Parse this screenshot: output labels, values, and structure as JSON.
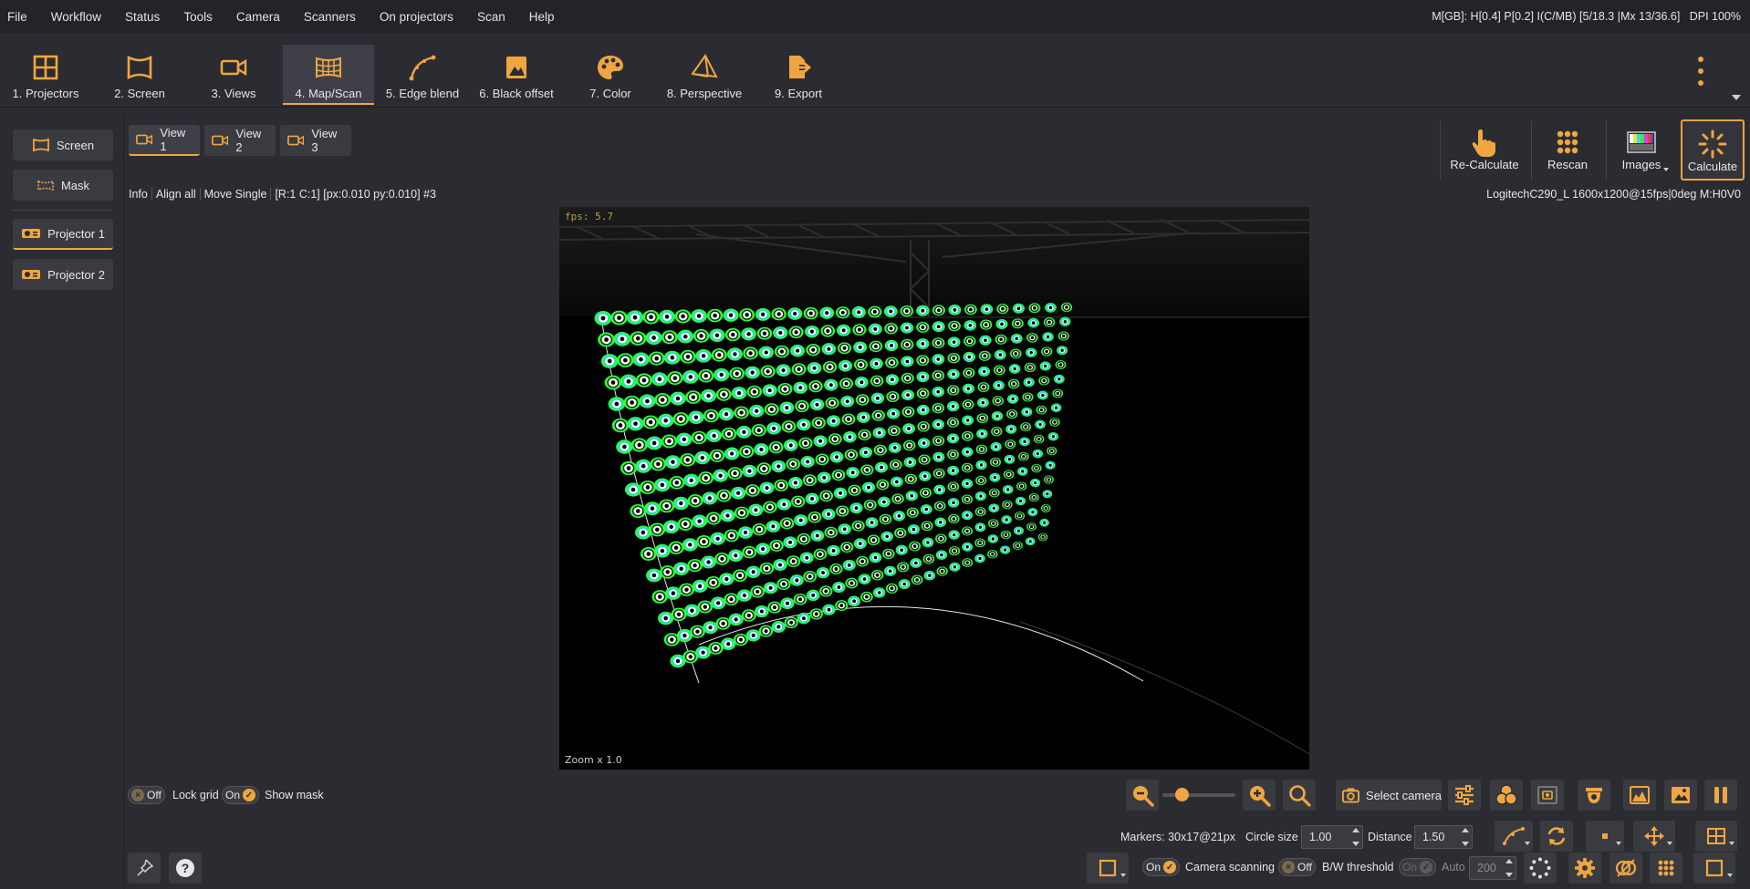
{
  "menu": {
    "items": [
      "File",
      "Workflow",
      "Status",
      "Tools",
      "Camera",
      "Scanners",
      "On projectors",
      "Scan",
      "Help"
    ],
    "status": "M[GB]: H[0.4] P[0.2] I(C/MB) [5/18.3 |Mx 13/36.6]",
    "dpi": "DPI 100%"
  },
  "toolbar": {
    "steps": [
      {
        "label": "1. Projectors",
        "icon": "projectors-grid-icon"
      },
      {
        "label": "2. Screen",
        "icon": "screen-icon"
      },
      {
        "label": "3. Views",
        "icon": "video-camera-icon"
      },
      {
        "label": "4. Map/Scan",
        "icon": "map-scan-grid-icon"
      },
      {
        "label": "5. Edge blend",
        "icon": "edge-blend-curve-icon"
      },
      {
        "label": "6. Black offset",
        "icon": "black-offset-icon"
      },
      {
        "label": "7. Color",
        "icon": "color-palette-icon"
      },
      {
        "label": "8. Perspective",
        "icon": "perspective-pyramid-icon"
      },
      {
        "label": "9. Export",
        "icon": "export-icon"
      }
    ],
    "active_step": "4. Map/Scan"
  },
  "sidebar": {
    "screen_label": "Screen",
    "mask_label": "Mask",
    "projector1_label": "Projector 1",
    "projector2_label": "Projector 2"
  },
  "views": {
    "tabs": [
      "View 1",
      "View 2",
      "View 3"
    ],
    "active": "View 1"
  },
  "info": {
    "items": [
      "Info",
      "Align all",
      "Move Single",
      "[R:1 C:1] [px:0.010 py:0.010] #3"
    ]
  },
  "camera_info": "LogitechC290_L 1600x1200@15fps|0deg M:H0V0",
  "actions": {
    "recalculate": "Re-Calculate",
    "rescan": "Rescan",
    "images": "Images",
    "calculate": "Calculate"
  },
  "viewport": {
    "fps": "fps: 5.7",
    "zoom": "Zoom x 1.0",
    "marker_grid": {
      "columns": 30,
      "rows": 17
    }
  },
  "controls": {
    "lock_grid": {
      "state": "Off",
      "label": "Lock grid"
    },
    "show_mask": {
      "state": "On",
      "label": "Show mask"
    },
    "select_camera": "Select camera",
    "markers": "Markers: 30x17@21px",
    "circle_size_label": "Circle size",
    "circle_size_value": "1.00",
    "distance_label": "Distance",
    "distance_value": "1.50",
    "camera_scanning": {
      "state": "On",
      "label": "Camera scanning"
    },
    "bw_threshold": {
      "state": "Off",
      "label": "B/W threshold"
    },
    "auto": {
      "state": "On",
      "label": "Auto",
      "value": "200"
    }
  },
  "colors": {
    "accent": "#f0a640",
    "background": "#2b2c31",
    "menubar": "#23242a",
    "marker_fill": "#2bff3c",
    "marker_ring": "#19d6e0"
  }
}
